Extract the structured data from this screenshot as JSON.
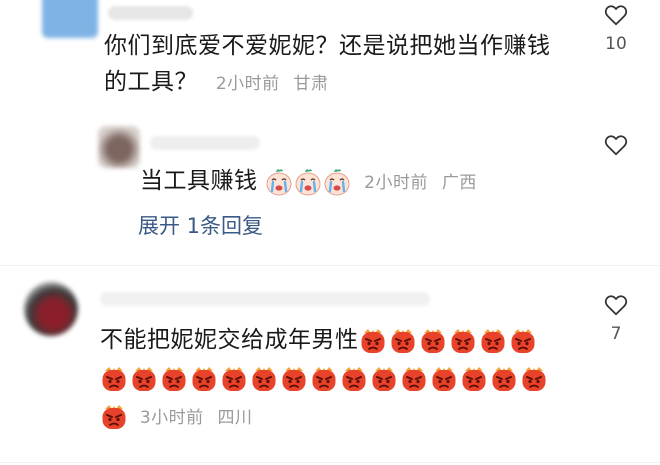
{
  "comments": [
    {
      "text_line1": "你们到底爱不爱妮妮？还是说把她当作赚钱",
      "text_line2": "的工具？",
      "time": "2小时前",
      "location": "甘肃",
      "likes": "10",
      "avatar_color": "#7fb3e6",
      "reply": {
        "text": "当工具赚钱",
        "emoji": "crying-face",
        "emoji_count": 3,
        "time": "2小时前",
        "location": "广西",
        "avatar_color": "#8a6f6a"
      },
      "expand_label": "展开 1条回复"
    },
    {
      "text": "不能把妮妮交给成年男性",
      "emoji": "angry-face",
      "emoji_count_line1": 6,
      "emoji_count_line2": 15,
      "emoji_count_line3": 1,
      "time": "3小时前",
      "location": "四川",
      "likes": "7",
      "avatar_color": "#5a3b40"
    }
  ],
  "colors": {
    "meta": "#9a9a9a",
    "link": "#3a5a88",
    "angry_red": "#e8432a",
    "cry_pink": "#f4a6a0"
  }
}
